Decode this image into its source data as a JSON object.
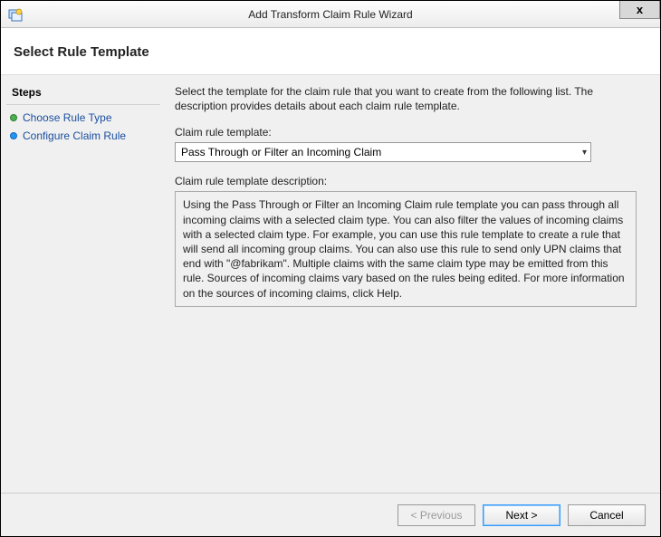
{
  "window": {
    "title": "Add Transform Claim Rule Wizard",
    "close_glyph": "x"
  },
  "header": {
    "title": "Select Rule Template"
  },
  "steps": {
    "heading": "Steps",
    "items": [
      {
        "label": "Choose Rule Type",
        "state": "current"
      },
      {
        "label": "Configure Claim Rule",
        "state": "pending"
      }
    ]
  },
  "content": {
    "instruction": "Select the template for the claim rule that you want to create from the following list. The description provides details about each claim rule template.",
    "template_label": "Claim rule template:",
    "template_value": "Pass Through or Filter an Incoming Claim",
    "description_label": "Claim rule template description:",
    "description_text": "Using the Pass Through or Filter an Incoming Claim rule template you can pass through all incoming claims with a selected claim type.  You can also filter the values of incoming claims with a selected claim type.  For example, you can use this rule template to create a rule that will send all incoming group claims.  You can also use this rule to send only UPN claims that end with \"@fabrikam\".  Multiple claims with the same claim type may be emitted from this rule.  Sources of incoming claims vary based on the rules being edited.  For more information on the sources of incoming claims, click Help."
  },
  "footer": {
    "previous": "< Previous",
    "next": "Next >",
    "cancel": "Cancel"
  }
}
